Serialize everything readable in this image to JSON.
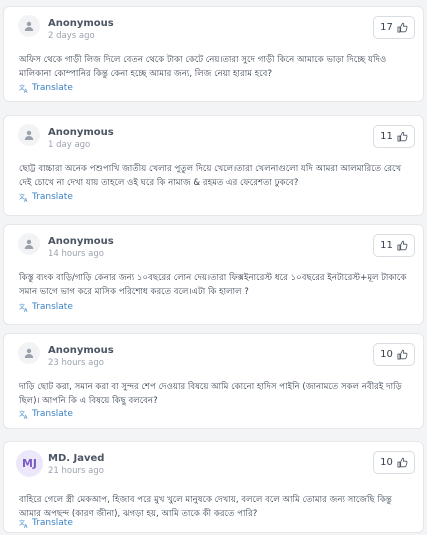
{
  "comments": [
    {
      "author": "Anonymous",
      "time": "2 days ago",
      "likes": "17",
      "avatar_icon": "user-icon",
      "text": "অফিস থেকে গাড়ী লিজ দিলে বেতন থেকে টাকা কেটে নেয়।তারা সুদে গাড়ী কিনে আমাকে ভাড়া দিচ্ছে যদিও মালিকানা কোম্পানির কিন্তু কেনা হচ্ছে আমার জন্য, লিজ নেয়া হারাম হবে?",
      "translate_label": "Translate"
    },
    {
      "author": "Anonymous",
      "time": "1 day ago",
      "likes": "11",
      "avatar_icon": "user-icon",
      "text": "ছোট্ট বাচ্চারা অনেক পশুপাখি জাতীয় খেলার পুতুল দিয়ে খেলে।তারা খেলনাগুলো যদি আমরা আলমারিতে রেখে দেই চোখে না দেখা যায় তাহলে ওই ঘরে কি নামাজ & রহমত এর ফেরেশতা ঢুকবে?",
      "translate_label": "Translate"
    },
    {
      "author": "Anonymous",
      "time": "14 hours ago",
      "likes": "11",
      "avatar_icon": "user-icon",
      "text": "কিস্তু ব্যংক বাড়ি/গাড়ি কেনার জন্য ১০বছরের লোন দেয়।তারা ফিক্সইনারেস্ট ধরে ১০বছরের ইনটারেস্ট+মূল টাকাকে সমান ভাগে ভাগ করে মাসিক পরিশোধ করতে বলে।এটা কি হালাল ?",
      "translate_label": "Translate"
    },
    {
      "author": "Anonymous",
      "time": "23 hours ago",
      "likes": "10",
      "avatar_icon": "user-icon",
      "text": "দাড়ি ছোট করা, সমান করা বা সুন্দর শেপ দেওয়ার বিষয়ে আমি কোনো হাদিস পাইনি (জানামতে সকল নবীরই দাড়ি ছিল)। আপনি কি এ বিষয়ে কিছু বলবেন?",
      "translate_label": "Translate"
    },
    {
      "author": "MD. Javed",
      "time": "21 hours ago",
      "likes": "10",
      "avatar_initials": "MJ",
      "text": "বাহিরে গেলে স্ত্রী মেকআপ, হিজাব পরে মুখ খুলে মানুষকে দেখায়, বললে বলে আমি তোমার জন্য সাজেছি কিন্তু আমার অপছন্দ (কারণ জীনা), ঝগড়া হয়, আমি তাকে কী করতে পারি?",
      "translate_label": "Translate"
    }
  ],
  "icons": {
    "like": "thumbs-up-icon",
    "translate": "translate-icon"
  },
  "colors": {
    "link": "#3b82c4",
    "avatar_initials_bg": "#ede7fb",
    "avatar_initials_text": "#7c5cc4"
  }
}
